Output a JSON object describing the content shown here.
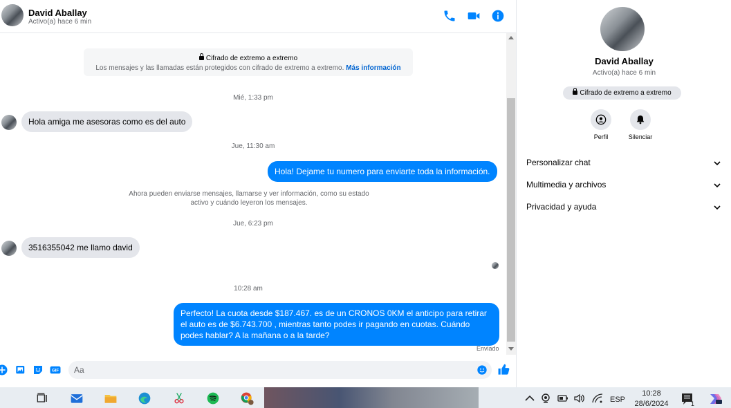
{
  "contact": {
    "name": "David Aballay",
    "status": "Activo(a) hace 6 min"
  },
  "encryption": {
    "title": "Cifrado de extremo a extremo",
    "description": "Los mensajes y las llamadas están protegidos con cifrado de extremo a extremo.",
    "link": "Más información"
  },
  "timeline": {
    "ts1": "Mié, 1:33 pm",
    "msg1": "Hola amiga me asesoras como es del auto",
    "ts2": "Jue, 11:30 am",
    "msg2": "Hola! Dejame tu numero  para enviarte toda la información.",
    "system_line1": "Ahora pueden enviarse mensajes, llamarse y ver información, como su estado",
    "system_line2": "activo y cuándo leyeron los mensajes.",
    "ts3": "Jue, 6:23 pm",
    "msg3": "3516355042 me llamo david",
    "ts4": "10:28 am",
    "msg4": "Perfecto! La cuota desde $187.467. es de un CRONOS 0KM el anticipo para retirar el auto es de $6.743.700 , mientras tanto podes ir pagando en cuotas. Cuándo podes hablar? A la mañana o a la tarde?",
    "delivered": "Enviado"
  },
  "composer": {
    "placeholder": "Aa"
  },
  "panel": {
    "encryption_badge": "Cifrado de extremo a extremo",
    "actions": {
      "profile": "Perfil",
      "mute": "Silenciar"
    },
    "sections": {
      "customize": "Personalizar chat",
      "media": "Multimedia y archivos",
      "privacy": "Privacidad y ayuda"
    }
  },
  "taskbar": {
    "language": "ESP",
    "time": "10:28",
    "date": "28/6/2024",
    "notification_count": "1"
  },
  "colors": {
    "accent": "#0084ff",
    "incoming_bubble": "#e4e6eb",
    "link": "#0064d1"
  }
}
